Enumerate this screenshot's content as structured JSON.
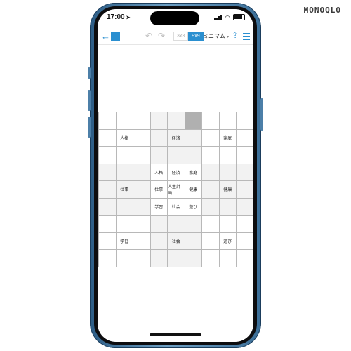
{
  "brand": "MONOQLO",
  "status_bar": {
    "time": "17:00",
    "location_icon": "location-arrow-icon",
    "signal_icon": "signal-icon",
    "wifi_icon": "wifi-icon",
    "battery_icon": "battery-icon"
  },
  "toolbar": {
    "back_icon": "back-arrow-icon",
    "app_logo_color": "#2a8fd0",
    "undo_icon": "undo-icon",
    "redo_icon": "redo-icon",
    "grid_toggle": [
      "3x3",
      "9x9"
    ],
    "grid_toggle_active": "9x9",
    "mode_select": "ミニマム",
    "share_icon": "share-icon",
    "menu_icon": "hamburger-menu-icon"
  },
  "accent_color": "#2a8fd0",
  "mandala": {
    "selected_cell": [
      0,
      5
    ],
    "cells": [
      [
        "",
        "",
        "",
        "",
        "",
        "",
        "",
        "",
        ""
      ],
      [
        "",
        "人格",
        "",
        "",
        "経済",
        "",
        "",
        "家庭",
        ""
      ],
      [
        "",
        "",
        "",
        "",
        "",
        "",
        "",
        "",
        ""
      ],
      [
        "",
        "",
        "",
        "人格",
        "経済",
        "家庭",
        "",
        "",
        ""
      ],
      [
        "",
        "仕事",
        "",
        "仕事",
        "人生計画",
        "健康",
        "",
        "健康",
        ""
      ],
      [
        "",
        "",
        "",
        "学習",
        "社会",
        "遊び",
        "",
        "",
        ""
      ],
      [
        "",
        "",
        "",
        "",
        "",
        "",
        "",
        "",
        ""
      ],
      [
        "",
        "学習",
        "",
        "",
        "社会",
        "",
        "",
        "遊び",
        ""
      ],
      [
        "",
        "",
        "",
        "",
        "",
        "",
        "",
        "",
        ""
      ]
    ]
  }
}
